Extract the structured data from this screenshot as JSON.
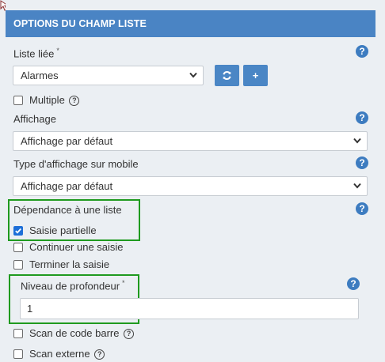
{
  "header": {
    "title": "OPTIONS DU CHAMP LISTE"
  },
  "linked_list": {
    "label": "Liste liée",
    "required_mark": "*",
    "value": "Alarmes",
    "refresh_icon": "refresh-icon",
    "add_label": "+"
  },
  "multiple": {
    "label": "Multiple",
    "checked": false
  },
  "display": {
    "label": "Affichage",
    "value": "Affichage par défaut"
  },
  "mobile_display": {
    "label": "Type d'affichage sur mobile",
    "value": "Affichage par défaut"
  },
  "dependency": {
    "label": "Dépendance à une liste"
  },
  "partial_entry": {
    "label": "Saisie partielle",
    "checked": true
  },
  "continue_entry": {
    "label": "Continuer une saisie",
    "checked": false
  },
  "finish_entry": {
    "label": "Terminer la saisie",
    "checked": false
  },
  "depth": {
    "label": "Niveau de profondeur",
    "required_mark": "*",
    "value": "1"
  },
  "barcode": {
    "label": "Scan de code barre",
    "checked": false
  },
  "external_scan": {
    "label": "Scan externe",
    "checked": false
  },
  "help_glyph": "?",
  "colors": {
    "header": "#4a84c4",
    "highlight": "#1f9a1f",
    "checkbox_on": "#1d6fd8"
  }
}
